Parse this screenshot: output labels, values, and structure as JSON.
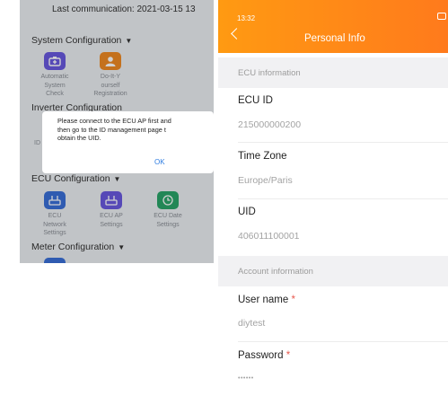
{
  "left": {
    "last_communication": "Last communication: 2021-03-15 13",
    "system_config": {
      "title": "System Configuration",
      "items": [
        {
          "label": "Automatic\nSystem\nCheck",
          "icon": "system-check-icon"
        },
        {
          "label": "Do-It-Y\nourself\nRegistration",
          "icon": "registration-icon"
        }
      ]
    },
    "inverter_config": {
      "title": "Inverter Configuration",
      "partial_label": "ID"
    },
    "dialog": {
      "message": "Please connect to the ECU AP first and\nthen go to the ID management page t\nobtain the UID.",
      "ok_label": "OK"
    },
    "ecu_config": {
      "title": "ECU Configuration",
      "items": [
        {
          "label": "ECU\nNetwork\nSettings",
          "icon": "router-icon"
        },
        {
          "label": "ECU AP\nSettings",
          "icon": "router-icon"
        },
        {
          "label": "ECU Date\nSettings",
          "icon": "clock-icon"
        }
      ]
    },
    "meter_config": {
      "title": "Meter Configuration"
    },
    "colors": {
      "purple": "#6a5ae0",
      "orange": "#f08a24",
      "blue": "#3a6fd8",
      "green": "#2aa56a"
    }
  },
  "right": {
    "status_time": "13:32",
    "title": "Personal Info",
    "ecu_section": "ECU information",
    "ecu_id": {
      "label": "ECU ID",
      "value": "215000000200"
    },
    "time_zone": {
      "label": "Time Zone",
      "value": "Europe/Paris"
    },
    "uid": {
      "label": "UID",
      "value": "406011100001"
    },
    "account_section": "Account information",
    "user_name": {
      "label": "User name",
      "required": "*",
      "value": "diytest"
    },
    "password": {
      "label": "Password",
      "required": "*",
      "value": "••••••"
    },
    "colors": {
      "header_start": "#ff9a12",
      "header_end": "#ff7a1c",
      "required": "#e85a4f"
    }
  }
}
